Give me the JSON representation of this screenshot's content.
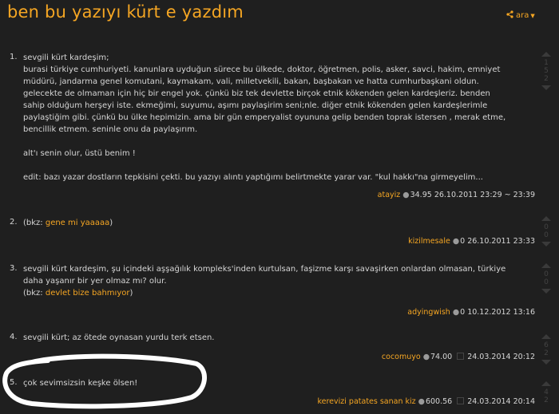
{
  "topic": {
    "title": "ben bu yazıyı kürt e yazdım",
    "share_label": "ara"
  },
  "entries": [
    {
      "number": "1.",
      "text": "sevgili kürt kardeşim;\nburasi türkiye cumhuriyeti. kanunlara uyduğun sürece bu ülkede, doktor, öğretmen, polis, asker, savci, hakim, emniyet\nmüdürü, jandarma genel komutani, kaymakam, vali, milletvekili, bakan, başbakan ve hatta cumhurbaşkani oldun.\ngelecekte de olmaman için hiç bir engel yok. çünkü biz tek devlette birçok etnik kökenden gelen kardeşleriz. benden\nsahip olduğum herşeyi iste. ekmeğimi, suyumu, aşımı paylaşirim seni;nle. diğer etnik kökenden gelen kardeşlerimle\npaylaştiğim gibi. çünkü bu ülke hepimizin. ama bir gün emperyalist oyununa gelip benden toprak istersen , merak etme,\nbencillik etmem. seninle onu da paylaşırım.\n\nalt'ı senin olur, üstü benim !\n\nedit: bazı yazar dostların tepkisini çekti. bu yazıyı alıntı yaptığımı belirtmekte yarar var. \"kul hakkı\"na girmeyelim...",
      "author": "atayiz",
      "score": "34.95",
      "date": "26.10.2011 23:29 ~ 23:39",
      "votes": [
        "1",
        "5",
        "2"
      ]
    },
    {
      "number": "2.",
      "prefix": "(bkz: ",
      "link": "gene mi yaaaaa",
      "suffix": ")",
      "author": "kizilmesale",
      "score": "0",
      "date": "26.10.2011 23:33",
      "votes": [
        "0",
        "0"
      ]
    },
    {
      "number": "3.",
      "text": "sevgili kürt kardeşim, şu içindeki aşşağılık kompleks'inden kurtulsan, faşizme karşı savaşirken onlardan olmasan, türkiye\ndaha yaşanır bir yer olmaz mı? olur.",
      "prefix": "(bkz: ",
      "link": "devlet bize bahmıyor",
      "suffix": ")",
      "author": "adyingwish",
      "score": "0",
      "date": "10.12.2012 13:16",
      "votes": [
        "0",
        "0"
      ]
    },
    {
      "number": "4.",
      "text": "sevgili kürt; az ötede oynasan yurdu terk etsen.",
      "author": "cocomuyo",
      "score": "74.00",
      "date": "24.03.2014 20:12",
      "votes": [
        "6",
        "2"
      ]
    },
    {
      "number": "5.",
      "text": "çok sevimsizsin keşke ölsen!",
      "author": "kerevizi patates sanan kiz",
      "score": "600.56",
      "date": "24.03.2014 20:14",
      "votes": [
        "4",
        "2"
      ]
    }
  ],
  "colors": {
    "background": "#1f1f1f",
    "accent": "#f5a623",
    "text": "#d6d6d6"
  }
}
